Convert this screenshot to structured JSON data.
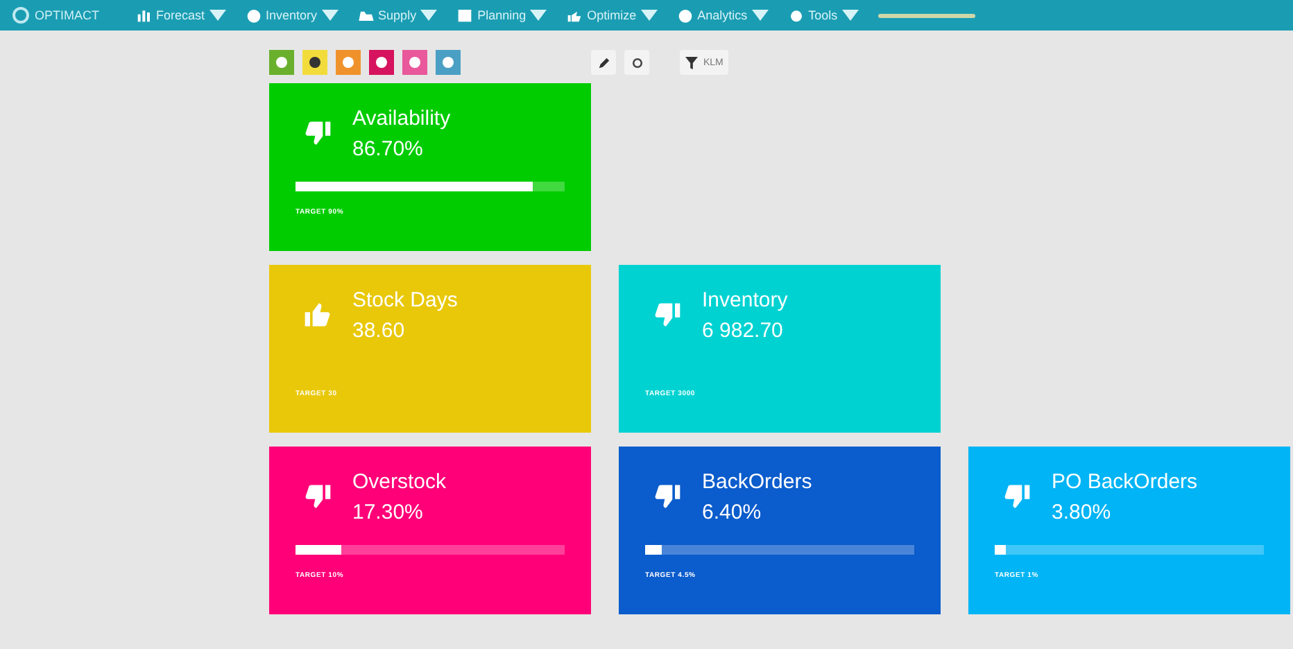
{
  "navbar": {
    "brand": "OPTIMACT",
    "menus": [
      {
        "label": "Forecast"
      },
      {
        "label": "Inventory"
      },
      {
        "label": "Supply"
      },
      {
        "label": "Planning"
      },
      {
        "label": "Optimize"
      },
      {
        "label": "Analytics"
      },
      {
        "label": "Tools"
      }
    ]
  },
  "toolbar": {
    "color_buttons": [
      {
        "color": "#6ab02c"
      },
      {
        "color": "#f2dc3c"
      },
      {
        "color": "#f0922c"
      },
      {
        "color": "#d6135e"
      },
      {
        "color": "#e8589a"
      },
      {
        "color": "#4a9fc4"
      }
    ],
    "filter": "KLM"
  },
  "rows": [
    [
      {
        "title": "Availability",
        "value": "86.70%",
        "thumbs_up": false,
        "color": "#00cc00",
        "level": 0.88,
        "target": "TARGET 90%"
      }
    ],
    [
      {
        "title": "Stock Days",
        "value": "38.60",
        "thumbs_up": true,
        "color": "#e9c80a",
        "target": "TARGET 30"
      },
      {
        "title": "Inventory",
        "value": "6 982.70",
        "thumbs_up": false,
        "color": "#00d2d2",
        "target": "TARGET 3000"
      }
    ],
    [
      {
        "title": "Overstock",
        "value": "17.30%",
        "thumbs_up": false,
        "color": "#ff0078",
        "level": 0.17,
        "target": "TARGET 10%"
      },
      {
        "title": "BackOrders",
        "value": "6.40%",
        "thumbs_up": false,
        "color": "#0b5ccc",
        "level": 0.06,
        "target": "TARGET 4.5%"
      },
      {
        "title": "PO BackOrders",
        "value": "3.80%",
        "thumbs_up": false,
        "color": "#00b4f5",
        "level": 0.04,
        "target": "TARGET 1%"
      }
    ]
  ]
}
